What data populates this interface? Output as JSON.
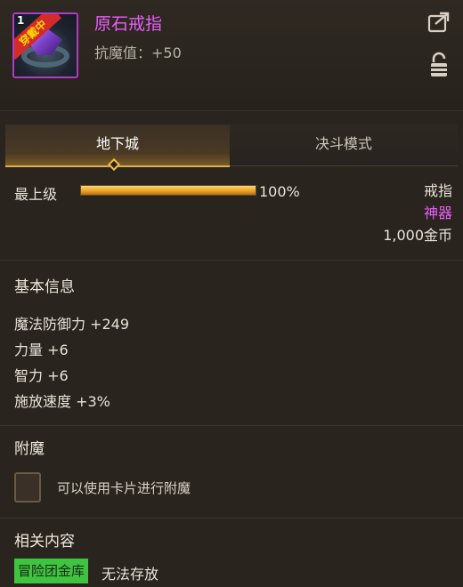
{
  "item": {
    "level_badge": "1",
    "equipped_label": "穿戴中",
    "name": "原石戒指",
    "stat": "抗魔值：+50"
  },
  "tabs": [
    {
      "label": "地下城",
      "active": true
    },
    {
      "label": "决斗模式",
      "active": false
    }
  ],
  "grade": {
    "label": "最上级",
    "percent_text": "100%",
    "fill_fraction": 1.0
  },
  "right_info": {
    "type": "戒指",
    "rarity": "神器",
    "price": "1,000金币"
  },
  "basic_info": {
    "title": "基本信息",
    "stats": [
      "魔法防御力 +249",
      "力量 +6",
      "智力 +6",
      "施放速度 +3%"
    ]
  },
  "enchant": {
    "title": "附魔",
    "hint": "可以使用卡片进行附魔"
  },
  "related": {
    "title": "相关内容",
    "badge": "冒险团金库",
    "status": "无法存放"
  },
  "colors": {
    "rarity": "#e85ef7",
    "accent_gold": "#e0b040",
    "badge_green": "#3fc43f",
    "background": "#2a241e"
  },
  "icons": [
    "share-icon",
    "lock-icon"
  ]
}
